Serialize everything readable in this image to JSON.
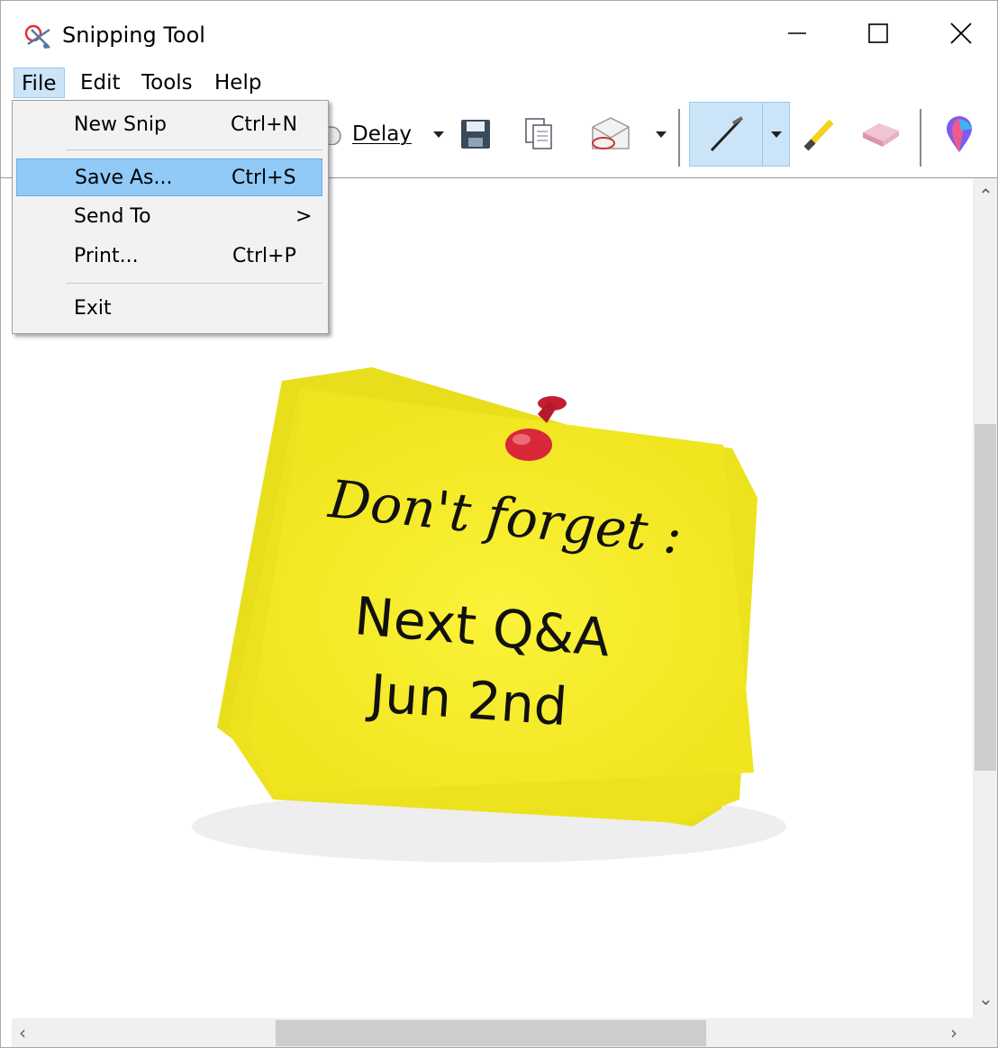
{
  "window": {
    "title": "Snipping Tool"
  },
  "menubar": {
    "items": [
      "File",
      "Edit",
      "Tools",
      "Help"
    ]
  },
  "toolbar": {
    "delay_label": "Delay"
  },
  "file_menu": {
    "items": [
      {
        "label": "New Snip",
        "shortcut": "Ctrl+N"
      },
      {
        "label": "Save As...",
        "shortcut": "Ctrl+S"
      },
      {
        "label": "Send To",
        "submenu": ">"
      },
      {
        "label": "Print...",
        "shortcut": "Ctrl+P"
      },
      {
        "label": "Exit"
      }
    ]
  },
  "note": {
    "line1": "Don't forget :",
    "line2": "Next Q&A",
    "line3": "Jun 2nd"
  },
  "colors": {
    "note_yellow": "#f6f02a",
    "pin_red": "#d8283a",
    "selection": "#91c9f7"
  }
}
